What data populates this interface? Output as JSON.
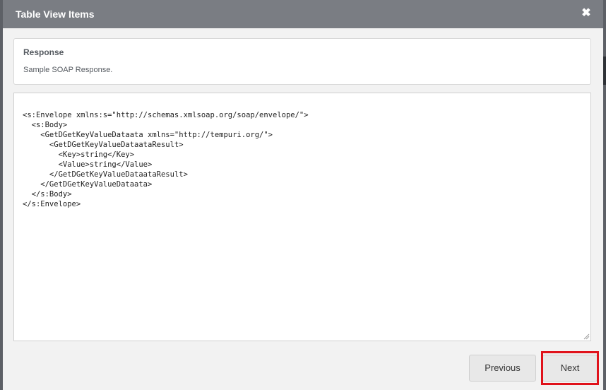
{
  "modal": {
    "title": "Table View Items",
    "close_glyph": "✖"
  },
  "info": {
    "title": "Response",
    "subtitle": "Sample SOAP Response."
  },
  "code": {
    "content": "<s:Envelope xmlns:s=\"http://schemas.xmlsoap.org/soap/envelope/\">\n  <s:Body>\n    <GetDGetKeyValueDataata xmlns=\"http://tempuri.org/\">\n      <GetDGetKeyValueDataataResult>\n        <Key>string</Key>\n        <Value>string</Value>\n      </GetDGetKeyValueDataataResult>\n    </GetDGetKeyValueDataata>\n  </s:Body>\n</s:Envelope>"
  },
  "footer": {
    "previous_label": "Previous",
    "next_label": "Next"
  },
  "colors": {
    "header_bg": "#7a7d83",
    "highlight": "#e0121b"
  }
}
